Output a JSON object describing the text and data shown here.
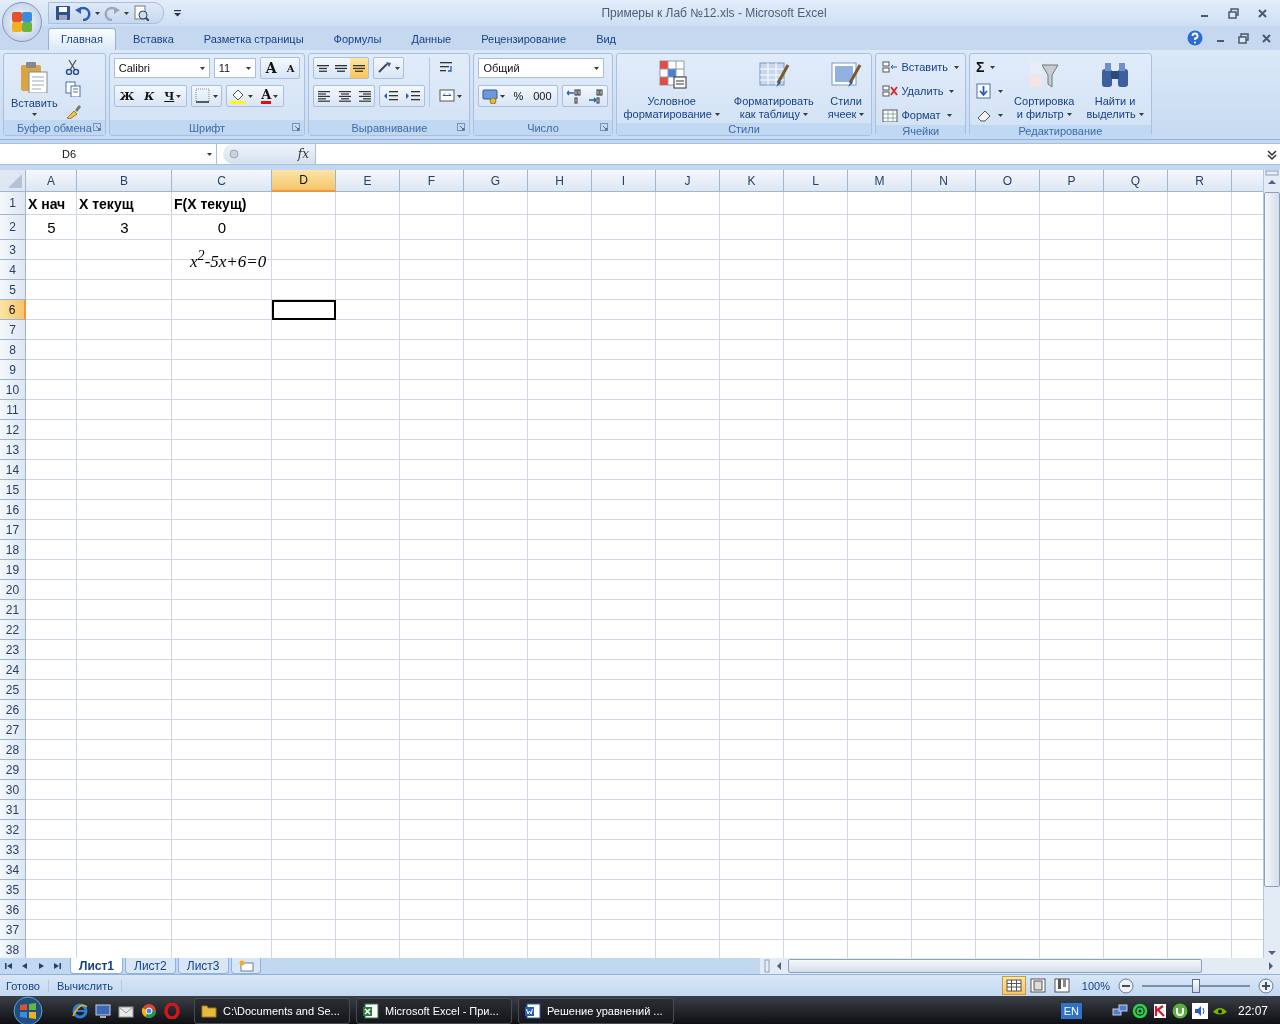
{
  "window": {
    "title": "Примеры к Лаб №12.xls - Microsoft Excel"
  },
  "ribbon_tabs": [
    {
      "label": "Главная",
      "selected": true
    },
    {
      "label": "Вставка",
      "selected": false
    },
    {
      "label": "Разметка страницы",
      "selected": false
    },
    {
      "label": "Формулы",
      "selected": false
    },
    {
      "label": "Данные",
      "selected": false
    },
    {
      "label": "Рецензирование",
      "selected": false
    },
    {
      "label": "Вид",
      "selected": false
    }
  ],
  "ribbon_groups": [
    {
      "kind": "clipboard",
      "label": "Буфер обмена",
      "paste": "Вставить"
    },
    {
      "kind": "font",
      "label": "Шрифт",
      "font": "Calibri",
      "size": "11",
      "grow": "A",
      "shrink": "A",
      "bold": "Ж",
      "italic": "К",
      "underline": "Ч",
      "font_color": "A"
    },
    {
      "kind": "alignment",
      "label": "Выравнивание",
      "vertical_align": [
        {
          "selected": false
        },
        {
          "selected": false
        },
        {
          "selected": true
        }
      ]
    },
    {
      "kind": "number",
      "label": "Число",
      "format": "Общий",
      "percent": "%",
      "thousands": "000"
    },
    {
      "kind": "styles",
      "label": "Стили",
      "buttons": [
        {
          "lines": [
            "Условное",
            "форматирование"
          ]
        },
        {
          "lines": [
            "Форматировать",
            "как таблицу"
          ]
        },
        {
          "lines": [
            "Стили",
            "ячеек"
          ]
        }
      ]
    },
    {
      "kind": "cells",
      "label": "Ячейки",
      "buttons": [
        "Вставить",
        "Удалить",
        "Формат"
      ]
    },
    {
      "kind": "editing",
      "label": "Редактирование",
      "sum": "Σ",
      "buttons": [
        {
          "lines": [
            "Сортировка",
            "и фильтр"
          ]
        },
        {
          "lines": [
            "Найти и",
            "выделить"
          ]
        }
      ]
    }
  ],
  "formula_bar": {
    "name_box": "D6",
    "function_label": "fx"
  },
  "sheet": {
    "columns": [
      {
        "label": "A",
        "selected": false
      },
      {
        "label": "B",
        "selected": false
      },
      {
        "label": "C",
        "selected": false
      },
      {
        "label": "D",
        "selected": true
      },
      {
        "label": "E",
        "selected": false
      },
      {
        "label": "F",
        "selected": false
      },
      {
        "label": "G",
        "selected": false
      },
      {
        "label": "H",
        "selected": false
      },
      {
        "label": "I",
        "selected": false
      },
      {
        "label": "J",
        "selected": false
      },
      {
        "label": "K",
        "selected": false
      },
      {
        "label": "L",
        "selected": false
      },
      {
        "label": "M",
        "selected": false
      },
      {
        "label": "N",
        "selected": false
      },
      {
        "label": "O",
        "selected": false
      },
      {
        "label": "P",
        "selected": false
      },
      {
        "label": "Q",
        "selected": false
      },
      {
        "label": "R",
        "selected": false
      }
    ],
    "rows": [
      {
        "label": "1",
        "selected": false,
        "bold": true,
        "centered": false,
        "cells": [
          "X нач",
          "X текущ",
          "F(X текущ)"
        ]
      },
      {
        "label": "2",
        "selected": false,
        "bold": false,
        "centered": true,
        "cells": [
          "5",
          "3",
          "0"
        ]
      },
      {
        "label": "3",
        "selected": false
      },
      {
        "label": "4",
        "selected": false
      },
      {
        "label": "5",
        "selected": false
      },
      {
        "label": "6",
        "selected": true
      },
      {
        "label": "7",
        "selected": false
      },
      {
        "label": "8",
        "selected": false
      },
      {
        "label": "9",
        "selected": false
      },
      {
        "label": "10",
        "selected": false
      },
      {
        "label": "11",
        "selected": false
      },
      {
        "label": "12",
        "selected": false
      },
      {
        "label": "13",
        "selected": false
      },
      {
        "label": "14",
        "selected": false
      },
      {
        "label": "15",
        "selected": false
      },
      {
        "label": "16",
        "selected": false
      },
      {
        "label": "17",
        "selected": false
      },
      {
        "label": "18",
        "selected": false
      },
      {
        "label": "19",
        "selected": false
      },
      {
        "label": "20",
        "selected": false
      },
      {
        "label": "21",
        "selected": false
      },
      {
        "label": "22",
        "selected": false
      },
      {
        "label": "23",
        "selected": false
      },
      {
        "label": "24",
        "selected": false
      },
      {
        "label": "25",
        "selected": false
      },
      {
        "label": "26",
        "selected": false
      },
      {
        "label": "27",
        "selected": false
      },
      {
        "label": "28",
        "selected": false
      },
      {
        "label": "29",
        "selected": false
      },
      {
        "label": "30",
        "selected": false
      },
      {
        "label": "31",
        "selected": false
      },
      {
        "label": "32",
        "selected": false
      },
      {
        "label": "33",
        "selected": false
      },
      {
        "label": "34",
        "selected": false
      },
      {
        "label": "35",
        "selected": false
      },
      {
        "label": "36",
        "selected": false
      },
      {
        "label": "37",
        "selected": false
      },
      {
        "label": "38",
        "selected": false
      }
    ],
    "equation": "x$^{2}$-5x+6=0"
  },
  "sheet_tabs": [
    {
      "label": "Лист1",
      "selected": true
    },
    {
      "label": "Лист2",
      "selected": false
    },
    {
      "label": "Лист3",
      "selected": false
    }
  ],
  "status_bar": {
    "items": [
      "Готово",
      "Вычислить"
    ],
    "views": [
      {
        "selected": true
      },
      {
        "selected": false
      },
      {
        "selected": false
      }
    ],
    "zoom": "100%",
    "zoom_slider": {
      "level": 0.5
    }
  },
  "taskbar": {
    "tasks": [
      {
        "kind": "folder",
        "label": "C:\\Documents and Se..."
      },
      {
        "kind": "excel",
        "label": "Microsoft Excel - При..."
      },
      {
        "kind": "word",
        "label": "Решение уравнений ..."
      }
    ],
    "language": "EN",
    "clock": "22:07"
  }
}
